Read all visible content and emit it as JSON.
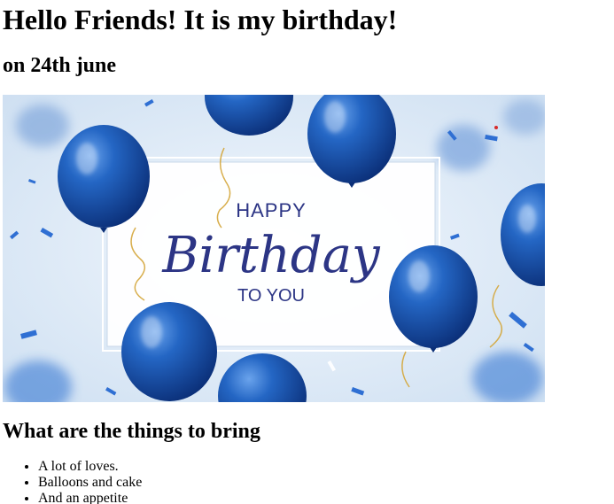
{
  "heading": "Hello Friends! It is my birthday!",
  "subheading": "on 24th june",
  "banner": {
    "happy": "HAPPY",
    "birthday": "Birthday",
    "to_you": "TO YOU",
    "colors": {
      "balloon": "#1e5bb5",
      "text": "#2c3585",
      "background": "#dce9f6"
    }
  },
  "section_title": "What are the things to bring",
  "items": [
    "A lot of loves.",
    "Balloons and cake",
    "And an appetite"
  ]
}
